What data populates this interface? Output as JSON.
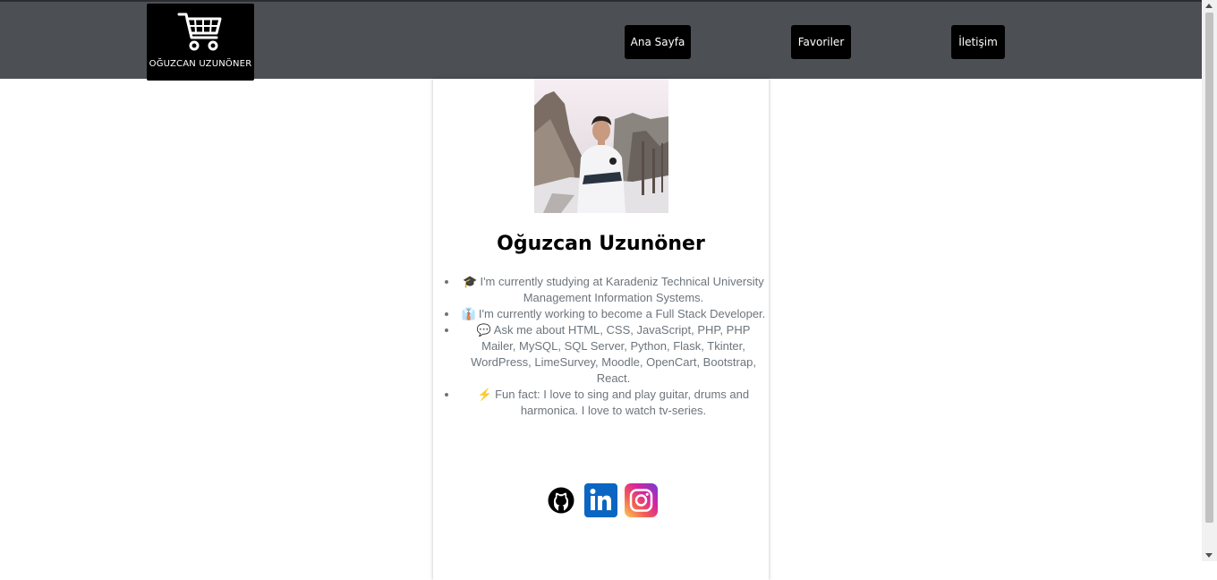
{
  "navbar": {
    "logo_text": "OĞUZCAN UZUNÖNER",
    "items": [
      {
        "label": "Ana Sayfa"
      },
      {
        "label": "Favoriler"
      },
      {
        "label": "İletişim"
      }
    ]
  },
  "profile": {
    "name": "Oğuzcan Uzunöner",
    "bio": [
      {
        "emoji": "🎓",
        "text": "I'm currently studying at Karadeniz Technical University Management Information Systems."
      },
      {
        "emoji": "👔",
        "text": "I'm currently working to become a Full Stack Developer."
      },
      {
        "emoji": "💬",
        "text": "Ask me about HTML, CSS, JavaScript, PHP, PHP Mailer, MySQL, SQL Server, Python, Flask, Tkinter, WordPress, LimeSurvey, Moodle, OpenCart, Bootstrap, React."
      },
      {
        "emoji": "⚡",
        "text": "Fun fact: I love to sing and play guitar, drums and harmonica. I love to watch tv-series."
      }
    ]
  },
  "socials": [
    {
      "icon": "github-icon"
    },
    {
      "icon": "linkedin-icon"
    },
    {
      "icon": "instagram-icon"
    }
  ],
  "colors": {
    "navbar_bg": "#4c5054",
    "button_bg": "#000000",
    "bio_text": "#6c757d",
    "linkedin": "#0a66c2"
  }
}
